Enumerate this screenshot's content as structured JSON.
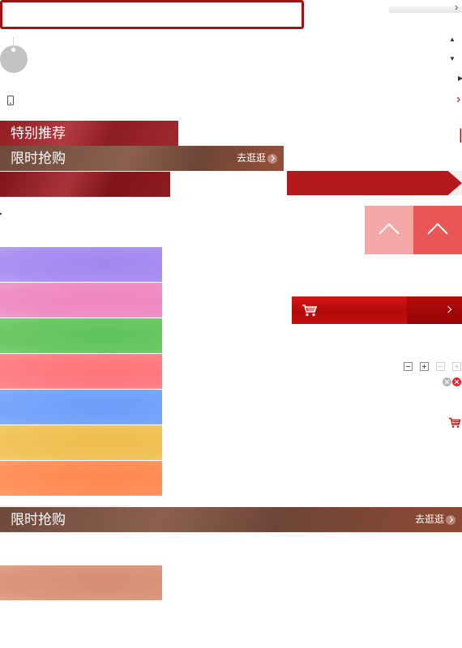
{
  "colors": {
    "brand_red": "#b4191d",
    "dark_red": "#8e1d22",
    "flash_brown": "#6e4a3b",
    "top_btn_light": "#f3a7a6",
    "top_btn_dark": "#e95757"
  },
  "banners": {
    "special_title": "特别推荐",
    "flash_title": "限时抢购",
    "flash_link": "去逛逛",
    "flash2_title": "限时抢购",
    "flash2_link": "去逛逛"
  },
  "icons": {
    "search_input": "search-box",
    "gift": "gift-ball-icon",
    "phone": "phone-icon",
    "back_to_top": "chevron-up-icon",
    "cart": "cart-icon",
    "clear": "close-circle-icon"
  },
  "glyphs": {
    "arrow_right_red": "›",
    "arrow_up": "▲",
    "arrow_down": "▼",
    "arrow_right_dark": "▶",
    "chevron_right_outline": "›",
    "pipe": "|"
  },
  "swatches": {
    "purple": "#ab91f1",
    "pink": "#f08fc4",
    "green": "#6cc966",
    "red": "#ff8085",
    "blue": "#78a6fb",
    "yellow": "#f1c45c",
    "orange": "#ff915c",
    "tan": "#db977e"
  }
}
